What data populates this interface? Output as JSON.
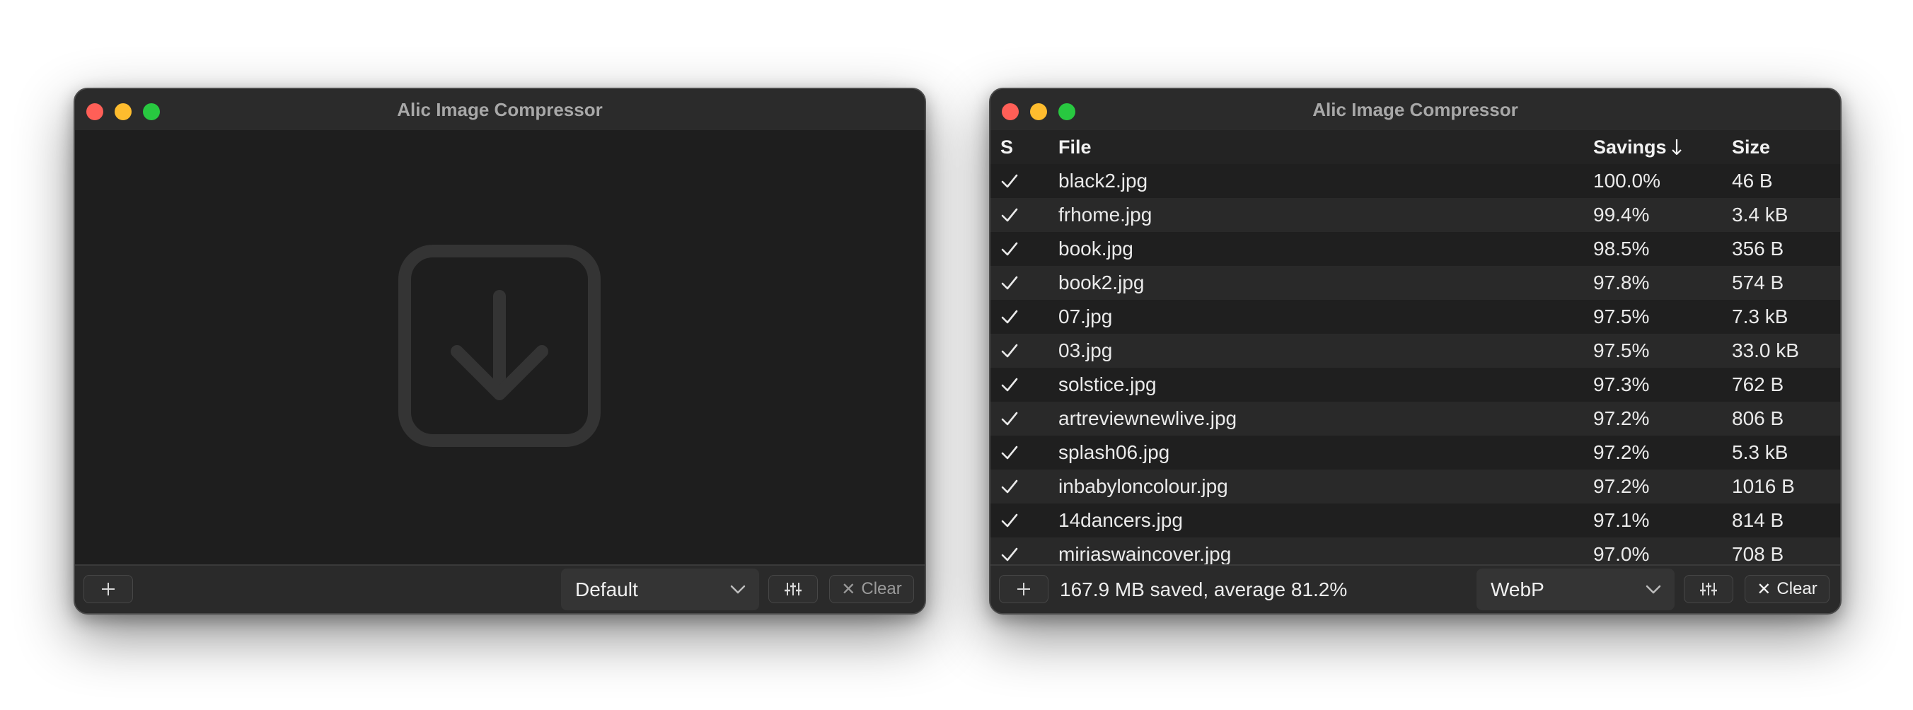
{
  "left_window": {
    "title": "Alic Image Compressor",
    "format_select": "Default",
    "clear_label": "Clear"
  },
  "right_window": {
    "title": "Alic Image Compressor",
    "columns": {
      "status": "S",
      "file": "File",
      "savings": "Savings",
      "size": "Size"
    },
    "rows": [
      {
        "file": "black2.jpg",
        "savings": "100.0%",
        "size": "46 B"
      },
      {
        "file": "frhome.jpg",
        "savings": "99.4%",
        "size": "3.4 kB"
      },
      {
        "file": "book.jpg",
        "savings": "98.5%",
        "size": "356 B"
      },
      {
        "file": "book2.jpg",
        "savings": "97.8%",
        "size": "574 B"
      },
      {
        "file": "07.jpg",
        "savings": "97.5%",
        "size": "7.3 kB"
      },
      {
        "file": "03.jpg",
        "savings": "97.5%",
        "size": "33.0 kB"
      },
      {
        "file": "solstice.jpg",
        "savings": "97.3%",
        "size": "762 B"
      },
      {
        "file": "artreviewnewlive.jpg",
        "savings": "97.2%",
        "size": "806 B"
      },
      {
        "file": "splash06.jpg",
        "savings": "97.2%",
        "size": "5.3 kB"
      },
      {
        "file": "inbabyloncolour.jpg",
        "savings": "97.2%",
        "size": "1016 B"
      },
      {
        "file": "14dancers.jpg",
        "savings": "97.1%",
        "size": "814 B"
      },
      {
        "file": "miriaswaincover.jpg",
        "savings": "97.0%",
        "size": "708 B"
      }
    ],
    "status_text": "167.9 MB saved, average 81.2%",
    "format_select": "WebP",
    "clear_label": "Clear"
  }
}
